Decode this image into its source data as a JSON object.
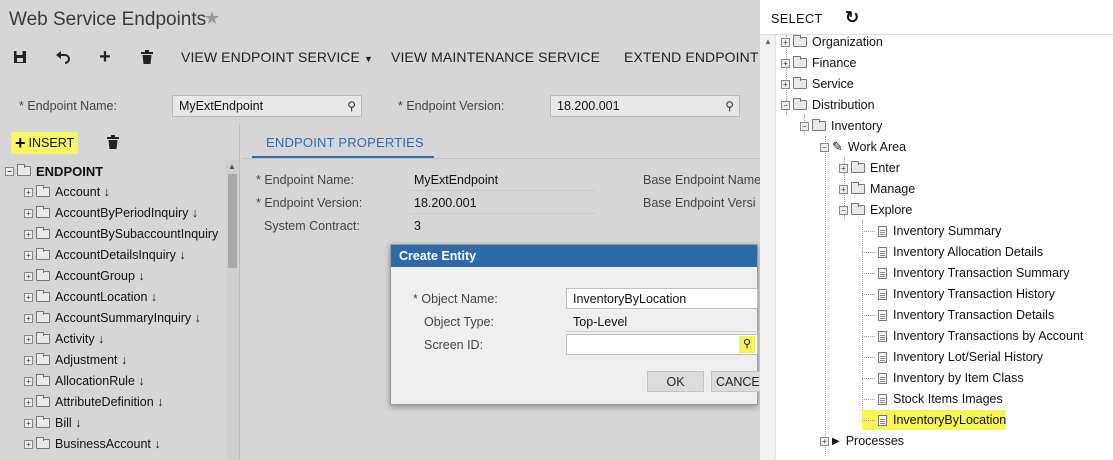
{
  "page": {
    "title": "Web Service Endpoints",
    "star_icon": "star-icon"
  },
  "toolbar": {
    "save_icon": "save-icon",
    "undo_icon": "undo-icon",
    "add_icon": "plus-icon",
    "delete_icon": "trash-icon",
    "view_endpoint_service": "VIEW ENDPOINT SERVICE",
    "view_maintenance_service": "VIEW MAINTENANCE SERVICE",
    "extend_endpoint": "EXTEND ENDPOINT"
  },
  "filters": {
    "endpoint_name_label": "Endpoint Name:",
    "endpoint_name_value": "MyExtEndpoint",
    "endpoint_version_label": "Endpoint Version:",
    "endpoint_version_value": "18.200.001"
  },
  "left_pane": {
    "insert_label": "INSERT",
    "root": "ENDPOINT",
    "items": [
      "Account ↓",
      "AccountByPeriodInquiry ↓",
      "AccountBySubaccountInquiry",
      "AccountDetailsInquiry ↓",
      "AccountGroup ↓",
      "AccountLocation ↓",
      "AccountSummaryInquiry ↓",
      "Activity ↓",
      "Adjustment ↓",
      "AllocationRule ↓",
      "AttributeDefinition ↓",
      "Bill ↓",
      "BusinessAccount ↓"
    ]
  },
  "properties": {
    "tab_label": "ENDPOINT PROPERTIES",
    "endpoint_name_label": "Endpoint Name:",
    "endpoint_name_value": "MyExtEndpoint",
    "endpoint_version_label": "Endpoint Version:",
    "endpoint_version_value": "18.200.001",
    "system_contract_label": "System Contract:",
    "system_contract_value": "3",
    "base_endpoint_name_label": "Base Endpoint Name",
    "base_endpoint_version_label": "Base Endpoint Versi"
  },
  "modal": {
    "title": "Create Entity",
    "object_name_label": "Object Name:",
    "object_name_value": "InventoryByLocation",
    "object_type_label": "Object Type:",
    "object_type_value": "Top-Level",
    "screen_id_label": "Screen ID:",
    "screen_id_value": "",
    "ok_label": "OK",
    "cancel_label": "CANCE"
  },
  "side_panel": {
    "select_label": "SELECT",
    "folders_top": [
      "Organization",
      "Finance",
      "Service",
      "Distribution"
    ],
    "inventory": "Inventory",
    "work_area": "Work Area",
    "enter": "Enter",
    "manage": "Manage",
    "explore": "Explore",
    "explore_items": [
      "Inventory Summary",
      "Inventory Allocation Details",
      "Inventory Transaction Summary",
      "Inventory Transaction History",
      "Inventory Transaction Details",
      "Inventory Transactions by Account",
      "Inventory Lot/Serial History",
      "Inventory by Item Class",
      "Stock Items Images",
      "InventoryByLocation"
    ],
    "processes": "Processes"
  },
  "colors": {
    "accent": "#2b6eb0",
    "highlight": "#f6f656",
    "modal_header": "#2e6aa8"
  }
}
